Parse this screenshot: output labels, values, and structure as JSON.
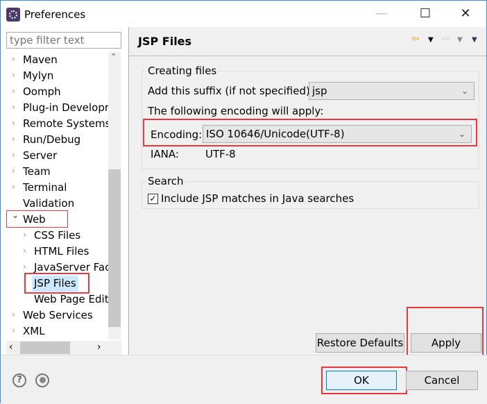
{
  "window": {
    "title": "Preferences",
    "minimize": "—",
    "maximize": "☐",
    "close": "✕"
  },
  "filter": {
    "placeholder": "type filter text"
  },
  "tree": [
    {
      "label": "Maven",
      "level": 0,
      "arrow": "›"
    },
    {
      "label": "Mylyn",
      "level": 0,
      "arrow": "›"
    },
    {
      "label": "Oomph",
      "level": 0,
      "arrow": "›"
    },
    {
      "label": "Plug-in Developr",
      "level": 0,
      "arrow": "›"
    },
    {
      "label": "Remote Systems",
      "level": 0,
      "arrow": "›"
    },
    {
      "label": "Run/Debug",
      "level": 0,
      "arrow": "›"
    },
    {
      "label": "Server",
      "level": 0,
      "arrow": "›"
    },
    {
      "label": "Team",
      "level": 0,
      "arrow": "›"
    },
    {
      "label": "Terminal",
      "level": 0,
      "arrow": "›"
    },
    {
      "label": "Validation",
      "level": 0,
      "arrow": ""
    },
    {
      "label": "Web",
      "level": 0,
      "arrow": "⌄"
    },
    {
      "label": "CSS Files",
      "level": 1,
      "arrow": "›"
    },
    {
      "label": "HTML Files",
      "level": 1,
      "arrow": "›"
    },
    {
      "label": "JavaServer Fac",
      "level": 1,
      "arrow": "›"
    },
    {
      "label": "JSP Files",
      "level": 1,
      "arrow": "›",
      "selected": true
    },
    {
      "label": "Web Page Edit",
      "level": 1,
      "arrow": ""
    },
    {
      "label": "Web Services",
      "level": 0,
      "arrow": "›"
    },
    {
      "label": "XML",
      "level": 0,
      "arrow": "›"
    }
  ],
  "page": {
    "title": "JSP Files",
    "creating": {
      "label": "Creating files",
      "suffix_label": "Add this suffix (if not specified):",
      "suffix_value": "jsp",
      "encoding_note": "The following encoding will apply:",
      "encoding_label": "Encoding:",
      "encoding_value": "ISO 10646/Unicode(UTF-8)",
      "iana_label": "IANA:",
      "iana_value": "UTF-8"
    },
    "search": {
      "label": "Search",
      "checkbox_label": "Include JSP matches in Java searches",
      "checked": true
    }
  },
  "buttons": {
    "restore": "Restore Defaults",
    "apply": "Apply",
    "ok": "OK",
    "cancel": "Cancel",
    "help": "?"
  },
  "colors": {
    "highlight": "#e8383d",
    "selection": "#cce8ff",
    "back_arrow": "#e8a317"
  }
}
